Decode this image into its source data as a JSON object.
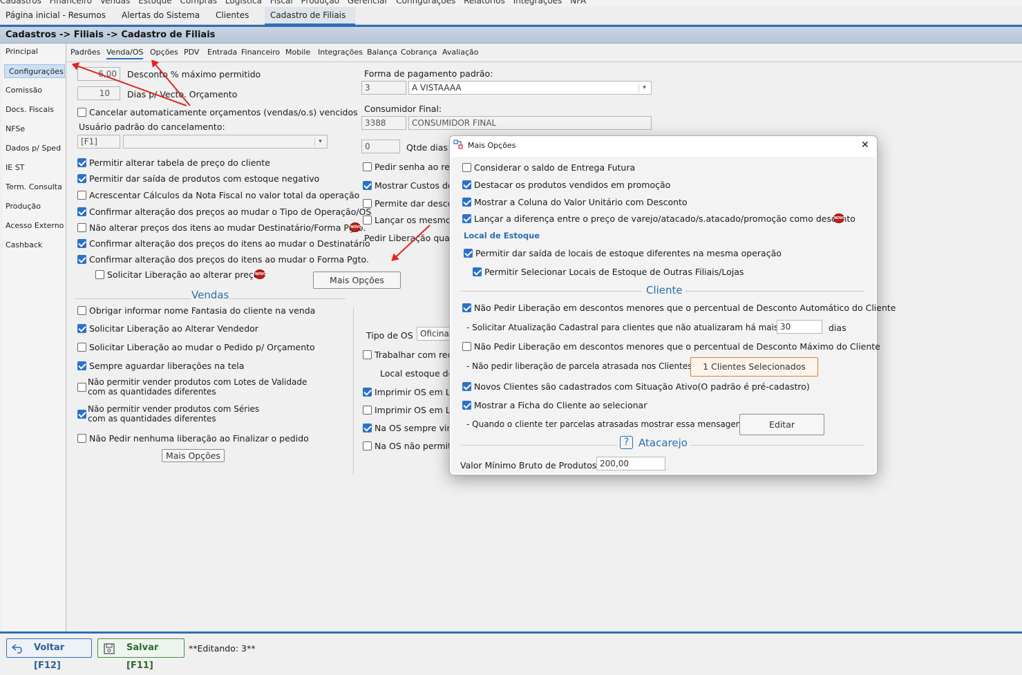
{
  "menu": [
    "Cadastros",
    "Financeiro",
    "Vendas",
    "Estoque",
    "Compras",
    "Logística",
    "Fiscal",
    "Produção",
    "Gerenciar",
    "Configurações",
    "Relatórios",
    "Integrações",
    "NFA"
  ],
  "tabs": [
    {
      "label": "Página inicial - Resumos"
    },
    {
      "label": "Alertas do Sistema"
    },
    {
      "label": "Clientes"
    },
    {
      "label": "Cadastro de Filiais"
    }
  ],
  "breadcrumb": "Cadastros -> Filiais -> Cadastro de Filiais",
  "leftnav": [
    "Principal",
    "Configurações",
    "Comissão",
    "Docs. Fiscais",
    "NFSe",
    "Dados p/ Sped",
    "IE ST",
    "Term. Consulta",
    "Produção",
    "Acesso Externo",
    "Cashback"
  ],
  "subtabs": [
    "Padrões",
    "Venda/OS",
    "Opções",
    "PDV",
    "Entrada",
    "Financeiro",
    "Mobile",
    "Integrações",
    "Balança",
    "Cobrança",
    "Avaliação"
  ],
  "form": {
    "desconto_value": "6,00",
    "desconto_label": "Desconto % máximo permitido",
    "dias_value": "10",
    "dias_label": "Dias p/ Vecto. Orçamento",
    "cancelar_label": "Cancelar automaticamente orçamentos (vendas/o.s) vencidos",
    "usuario_label": "Usuário padrão do cancelamento:",
    "usuario_code": "[F1]",
    "forma_label": "Forma de pagamento padrão:",
    "forma_code": "3",
    "forma_value": "A VISTAAAA",
    "consumidor_label": "Consumidor Final:",
    "consumidor_code": "3388",
    "consumidor_value": "CONSUMIDOR FINAL",
    "qtde_value": "0",
    "qtde_label": "Qtde dias"
  },
  "left_checks": [
    {
      "label": "Permitir alterar tabela de preço do cliente",
      "checked": true
    },
    {
      "label": "Permitir dar saída de produtos com estoque negativo",
      "checked": true
    },
    {
      "label": "Acrescentar Cálculos da Nota Fiscal no valor total da operação",
      "checked": false
    },
    {
      "label": "Confirmar alteração dos preços ao mudar o Tipo de Operação/OS",
      "checked": true
    },
    {
      "label": "Não alterar preços dos itens ao mudar Destinatário/Forma Pgto.",
      "checked": false
    },
    {
      "label": "Confirmar alteração dos preços do itens ao mudar o Destinatário",
      "checked": true
    },
    {
      "label": "Confirmar alteração dos preços do itens ao mudar o Forma Pgto.",
      "checked": true
    }
  ],
  "solicitar_label": "Solicitar Liberação ao alterar preços",
  "mais_opcoes_label": "Mais Opções",
  "new_badge": "NOVO",
  "right_checks": [
    {
      "label": "Pedir senha ao rea",
      "checked": false
    },
    {
      "label": "Mostrar Custos do",
      "checked": true
    },
    {
      "label": "Permite dar desco",
      "checked": false
    },
    {
      "label": "Lançar os mesmos",
      "checked": false
    }
  ],
  "pedir_lib_label": "Pedir Liberação quan",
  "vendas_title": "Vendas",
  "vendas_checks": [
    {
      "label": "Obrigar informar nome Fantasia do cliente na venda",
      "checked": false
    },
    {
      "label": "Solicitar Liberação ao Alterar Vendedor",
      "checked": true
    },
    {
      "label": "Solicitar Liberação ao mudar o Pedido p/ Orçamento",
      "checked": false
    },
    {
      "label": "Sempre aguardar liberações na tela",
      "checked": true
    }
  ],
  "lotes_label_1": "Não permitir vender produtos com Lotes de Validade",
  "lotes_label_2": "com as quantidades diferentes",
  "series_label_1": "Não permitir vender produtos com Séries",
  "series_label_2": "com as quantidades diferentes",
  "nao_pedir_finalizar": "Não Pedir nenhuma liberação ao Finalizar o pedido",
  "tipo_os_label": "Tipo de OS",
  "tipo_os_value": "Oficina",
  "os_checks": [
    {
      "label": "Trabalhar com req",
      "checked": false
    },
    {
      "label": "Imprimir OS em La",
      "checked": true
    },
    {
      "label": "Imprimir OS em La",
      "checked": false
    },
    {
      "label": "Na OS sempre vin",
      "checked": true
    },
    {
      "label": "Na OS não permiti",
      "checked": false
    }
  ],
  "local_estoque_partial": "Local estoque de",
  "dialog": {
    "title": "Mais Opções",
    "checks_top": [
      {
        "label": "Considerar o saldo de Entrega Futura",
        "checked": false
      },
      {
        "label": "Destacar os produtos vendidos em promoção",
        "checked": true
      },
      {
        "label": "Mostrar a Coluna do Valor Unitário com Desconto",
        "checked": true
      },
      {
        "label": "Lançar a diferença entre o preço de varejo/atacado/s.atacado/promoção como desconto",
        "checked": true
      }
    ],
    "local_estoque_title": "Local de Estoque",
    "local_checks": [
      {
        "label": "Permitir dar saída de locais de estoque diferentes na mesma operação",
        "checked": true
      },
      {
        "label": "Permitir Selecionar Locais de Estoque de Outras Filiais/Lojas",
        "checked": true
      }
    ],
    "cliente_title": "Cliente",
    "nao_pedir_auto": "Não Pedir Liberação em descontos menores que o percentual de Desconto Automático do Cliente",
    "solicitar_atualizacao": "- Solicitar Atualização Cadastral para clientes que não atualizaram há mais de",
    "dias_value": "30",
    "dias_label": "dias",
    "nao_pedir_max": "Não Pedir Liberação em descontos menores que o percentual de Desconto Máximo do Cliente",
    "nao_pedir_parcela": "- Não pedir liberação de parcela atrasada nos Clientes:",
    "clientes_btn": "1 Clientes Selecionados",
    "novos_clientes": "Novos Clientes são cadastrados com Situação Ativo(O padrão é pré-cadastro)",
    "mostrar_ficha": "Mostrar a Ficha do Cliente ao selecionar",
    "parcelas_msg": "- Quando o cliente ter parcelas atrasadas mostrar essa mensagem:",
    "editar_btn": "Editar",
    "atacarejo_title": "Atacarejo",
    "valor_minimo_label": "Valor Mínimo Bruto de Produtos",
    "valor_minimo_value": "200,00",
    "help_glyph": "?",
    "close_glyph": "✕"
  },
  "bottom": {
    "voltar": "Voltar [F12]",
    "salvar": "Salvar [F11]",
    "status": "**Editando: 3**"
  },
  "colors": {
    "accent": "#2d6fb5",
    "arrow": "#e02424",
    "badge": "#c0201a",
    "selected_btn_border": "#d08040"
  }
}
